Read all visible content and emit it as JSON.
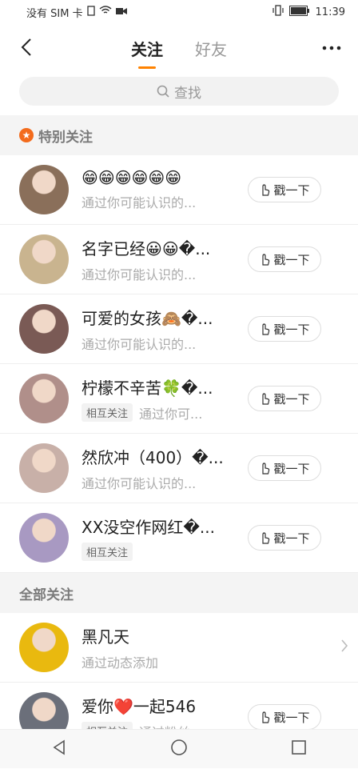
{
  "status": {
    "carrier": "没有 SIM 卡",
    "time": "11:39"
  },
  "tabs": [
    {
      "label": "关注",
      "active": true
    },
    {
      "label": "好友",
      "active": false
    }
  ],
  "search": {
    "placeholder": "查找"
  },
  "special_section": {
    "title": "特别关注"
  },
  "special": [
    {
      "name": "😁😁😁😁😁😁",
      "sub": "通过你可能认识的...",
      "tag": "",
      "poke": "戳一下",
      "avatar_color": "#8a6f5a"
    },
    {
      "name": "名字已经😀😀�...",
      "sub": "通过你可能认识的...",
      "tag": "",
      "poke": "戳一下",
      "avatar_color": "#c9b48f"
    },
    {
      "name": "可爱的女孩🙈�...",
      "sub": "通过你可能认识的...",
      "tag": "",
      "poke": "戳一下",
      "avatar_color": "#7a5a55"
    },
    {
      "name": "柠檬不辛苦🍀�...",
      "sub": "通过你可...",
      "tag": "相互关注",
      "poke": "戳一下",
      "avatar_color": "#b08f8a"
    },
    {
      "name": "然欣冲（400）�...",
      "sub": "通过你可能认识的...",
      "tag": "",
      "poke": "戳一下",
      "avatar_color": "#c8b0a8"
    },
    {
      "name": "XX没空作网红�...",
      "sub": "",
      "tag": "相互关注",
      "poke": "戳一下",
      "avatar_color": "#a899c2"
    }
  ],
  "all_section": {
    "title": "全部关注"
  },
  "all": [
    {
      "name": "黑凡天",
      "sub": "通过动态添加",
      "tag": "",
      "poke": "",
      "avatar_color": "#e9b90f"
    },
    {
      "name": "爱你❤️一起546",
      "sub": "通过粉丝",
      "tag": "相互关注",
      "poke": "戳一下",
      "avatar_color": "#6b6f7a"
    }
  ],
  "colors": {
    "accent": "#ff8200",
    "star": "#f36b1c"
  }
}
